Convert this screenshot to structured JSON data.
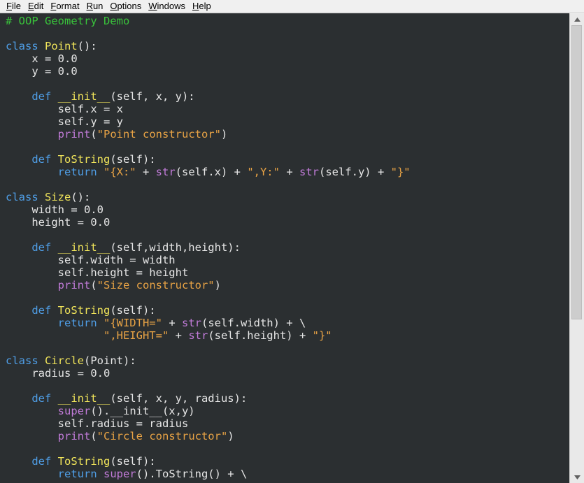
{
  "menubar": {
    "items": [
      {
        "acc": "F",
        "rest": "ile"
      },
      {
        "acc": "E",
        "rest": "dit"
      },
      {
        "acc": "F",
        "rest": "ormat",
        "pre": ""
      },
      {
        "acc": "R",
        "rest": "un"
      },
      {
        "acc": "O",
        "rest": "ptions"
      },
      {
        "acc": "W",
        "rest": "indows"
      },
      {
        "acc": "H",
        "rest": "elp"
      }
    ]
  },
  "scroll": {
    "position_fraction": 0.0,
    "visible_fraction": 0.66
  },
  "code": [
    [
      [
        "comment",
        "# OOP Geometry Demo"
      ]
    ],
    [],
    [
      [
        "keyword",
        "class "
      ],
      [
        "name",
        "Point"
      ],
      [
        "plain",
        "():"
      ]
    ],
    [
      [
        "plain",
        "    x = 0.0"
      ]
    ],
    [
      [
        "plain",
        "    y = 0.0"
      ]
    ],
    [],
    [
      [
        "plain",
        "    "
      ],
      [
        "keyword",
        "def "
      ],
      [
        "name",
        "__init__"
      ],
      [
        "plain",
        "(self, x, y):"
      ]
    ],
    [
      [
        "plain",
        "        self.x = x"
      ]
    ],
    [
      [
        "plain",
        "        self.y = y"
      ]
    ],
    [
      [
        "plain",
        "        "
      ],
      [
        "builtin",
        "print"
      ],
      [
        "plain",
        "("
      ],
      [
        "string",
        "\"Point constructor\""
      ],
      [
        "plain",
        ")"
      ]
    ],
    [],
    [
      [
        "plain",
        "    "
      ],
      [
        "keyword",
        "def "
      ],
      [
        "name",
        "ToString"
      ],
      [
        "plain",
        "(self):"
      ]
    ],
    [
      [
        "plain",
        "        "
      ],
      [
        "keyword",
        "return "
      ],
      [
        "string",
        "\"{X:\""
      ],
      [
        "plain",
        " + "
      ],
      [
        "builtin",
        "str"
      ],
      [
        "plain",
        "(self.x) + "
      ],
      [
        "string",
        "\",Y:\""
      ],
      [
        "plain",
        " + "
      ],
      [
        "builtin",
        "str"
      ],
      [
        "plain",
        "(self.y) + "
      ],
      [
        "string",
        "\"}\""
      ]
    ],
    [],
    [
      [
        "keyword",
        "class "
      ],
      [
        "name",
        "Size"
      ],
      [
        "plain",
        "():"
      ]
    ],
    [
      [
        "plain",
        "    width = 0.0"
      ]
    ],
    [
      [
        "plain",
        "    height = 0.0"
      ]
    ],
    [],
    [
      [
        "plain",
        "    "
      ],
      [
        "keyword",
        "def "
      ],
      [
        "name",
        "__init__"
      ],
      [
        "plain",
        "(self,width,height):"
      ]
    ],
    [
      [
        "plain",
        "        self.width = width"
      ]
    ],
    [
      [
        "plain",
        "        self.height = height"
      ]
    ],
    [
      [
        "plain",
        "        "
      ],
      [
        "builtin",
        "print"
      ],
      [
        "plain",
        "("
      ],
      [
        "string",
        "\"Size constructor\""
      ],
      [
        "plain",
        ")"
      ]
    ],
    [],
    [
      [
        "plain",
        "    "
      ],
      [
        "keyword",
        "def "
      ],
      [
        "name",
        "ToString"
      ],
      [
        "plain",
        "(self):"
      ]
    ],
    [
      [
        "plain",
        "        "
      ],
      [
        "keyword",
        "return "
      ],
      [
        "string",
        "\"{WIDTH=\""
      ],
      [
        "plain",
        " + "
      ],
      [
        "builtin",
        "str"
      ],
      [
        "plain",
        "(self.width) + \\"
      ]
    ],
    [
      [
        "plain",
        "               "
      ],
      [
        "string",
        "\",HEIGHT=\""
      ],
      [
        "plain",
        " + "
      ],
      [
        "builtin",
        "str"
      ],
      [
        "plain",
        "(self.height) + "
      ],
      [
        "string",
        "\"}\""
      ]
    ],
    [],
    [
      [
        "keyword",
        "class "
      ],
      [
        "name",
        "Circle"
      ],
      [
        "plain",
        "(Point):"
      ]
    ],
    [
      [
        "plain",
        "    radius = 0.0"
      ]
    ],
    [],
    [
      [
        "plain",
        "    "
      ],
      [
        "keyword",
        "def "
      ],
      [
        "name",
        "__init__"
      ],
      [
        "plain",
        "(self, x, y, radius):"
      ]
    ],
    [
      [
        "plain",
        "        "
      ],
      [
        "builtin",
        "super"
      ],
      [
        "plain",
        "().__init__(x,y)"
      ]
    ],
    [
      [
        "plain",
        "        self.radius = radius"
      ]
    ],
    [
      [
        "plain",
        "        "
      ],
      [
        "builtin",
        "print"
      ],
      [
        "plain",
        "("
      ],
      [
        "string",
        "\"Circle constructor\""
      ],
      [
        "plain",
        ")"
      ]
    ],
    [],
    [
      [
        "plain",
        "    "
      ],
      [
        "keyword",
        "def "
      ],
      [
        "name",
        "ToString"
      ],
      [
        "plain",
        "(self):"
      ]
    ],
    [
      [
        "plain",
        "        "
      ],
      [
        "keyword",
        "return "
      ],
      [
        "builtin",
        "super"
      ],
      [
        "plain",
        "().ToString() + \\"
      ]
    ]
  ]
}
